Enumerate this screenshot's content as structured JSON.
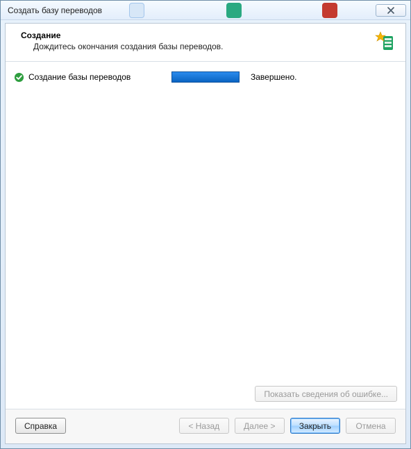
{
  "window": {
    "title": "Создать базу переводов"
  },
  "header": {
    "title": "Создание",
    "subtitle": "Дождитесь окончания создания базы переводов."
  },
  "task": {
    "label": "Создание базы переводов",
    "status": "Завершено.",
    "progress_percent": 100
  },
  "buttons": {
    "show_error": "Показать сведения об ошибке...",
    "help": "Справка",
    "back": "< Назад",
    "next": "Далее >",
    "close": "Закрыть",
    "cancel": "Отмена"
  }
}
